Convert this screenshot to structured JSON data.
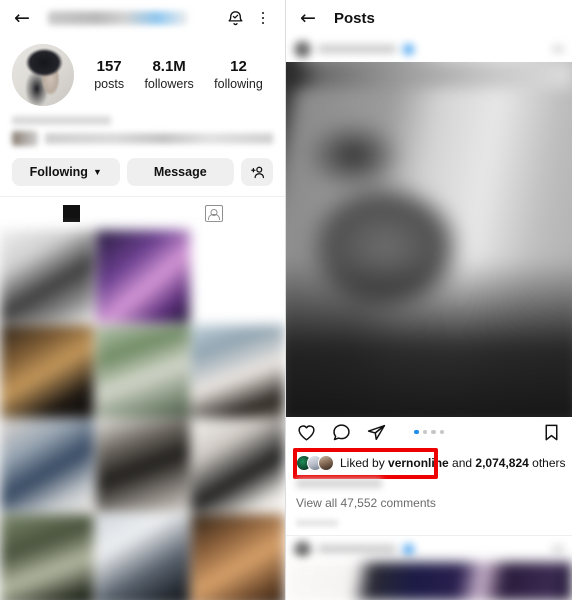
{
  "left_panel": {
    "header": {
      "back_icon": "arrow-left-icon",
      "username_placeholder": "",
      "notification_icon": "bell-check-icon",
      "menu_icon": "more-vertical-icon"
    },
    "avatar": "profile-avatar",
    "stats": [
      {
        "number": "157",
        "label": "posts"
      },
      {
        "number": "8.1M",
        "label": "followers"
      },
      {
        "number": "12",
        "label": "following"
      }
    ],
    "actions": {
      "following_label": "Following",
      "following_chevron": "chevron-down-icon",
      "message_label": "Message",
      "add_user_icon": "add-person-icon"
    },
    "tabs": [
      {
        "name": "grid",
        "icon": "grid-icon",
        "active": true
      },
      {
        "name": "tagged",
        "icon": "tagged-person-icon",
        "active": false
      }
    ],
    "grid_cells": 12
  },
  "right_panel": {
    "header": {
      "back_icon": "arrow-left-icon",
      "title": "Posts"
    },
    "post": {
      "carousel_dots": 4,
      "carousel_active_index": 0,
      "actions": {
        "like_icon": "heart-icon",
        "comment_icon": "comment-icon",
        "share_icon": "share-icon",
        "save_icon": "bookmark-icon"
      },
      "likes": {
        "prefix": "Liked by ",
        "username": "vernonline",
        "middle": " and ",
        "count": "2,074,824",
        "suffix": " others",
        "full_text": "Liked by vernonline and 2,074,824 others"
      },
      "comments_label": "View all 47,552 comments"
    }
  },
  "annotation": {
    "highlight_color": "#ee0000",
    "highlight_target": "liked-by-row"
  }
}
